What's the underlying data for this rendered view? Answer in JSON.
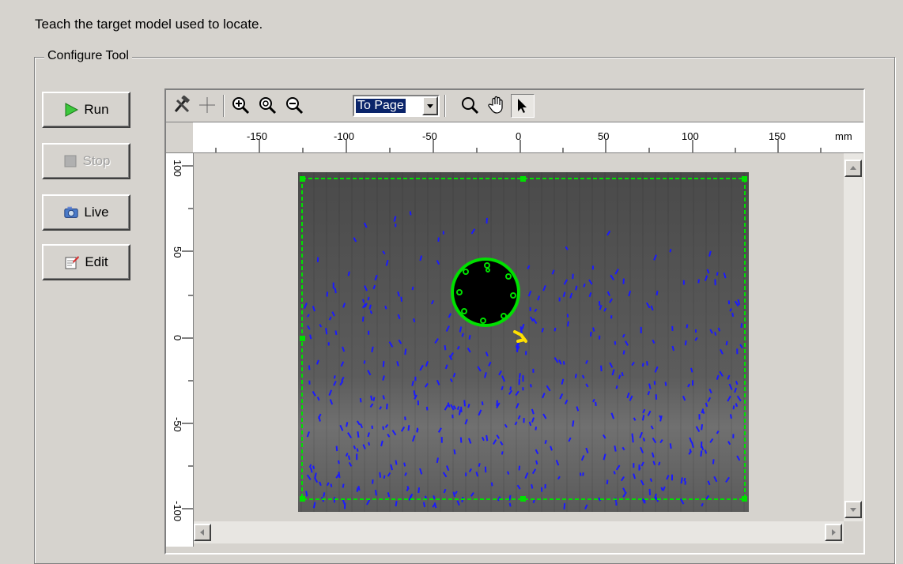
{
  "page": {
    "title": "Teach the target model used to locate."
  },
  "group": {
    "label": "Configure Tool"
  },
  "buttons": {
    "run": "Run",
    "stop": "Stop",
    "live": "Live",
    "edit": "Edit"
  },
  "toolbar": {
    "zoom_value": "To Page",
    "icons": [
      "tools-icon",
      "crosshair-icon",
      "zoom-in-icon",
      "zoom-fit-icon",
      "zoom-out-icon",
      "magnifier-icon",
      "pan-hand-icon",
      "pointer-arrow-icon"
    ]
  },
  "ruler": {
    "unit": "mm",
    "x_labels": [
      "-150",
      "-100",
      "-50",
      "0",
      "50",
      "100",
      "150"
    ],
    "y_labels": [
      "100",
      "50",
      "0",
      "-50",
      "-100"
    ]
  },
  "colors": {
    "region_outline": "#00e000",
    "feature_points": "#1a1aff",
    "origin_marker": "#ffe000",
    "selection_bg": "#0a246a"
  }
}
